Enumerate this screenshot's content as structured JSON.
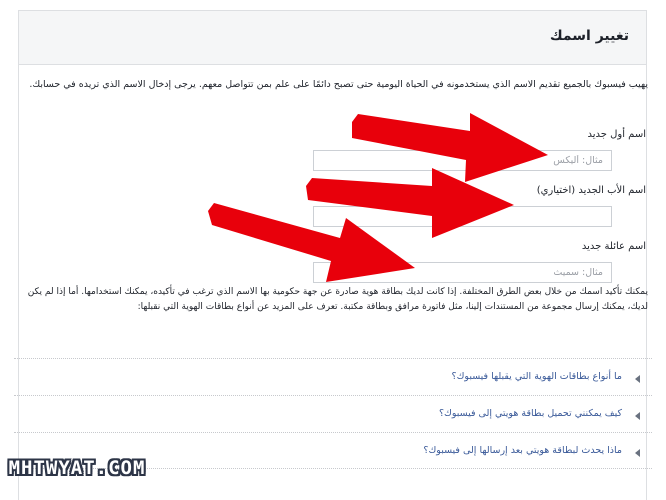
{
  "panel": {
    "title": "تغيير اسمك"
  },
  "intro": "يهيب فيسبوك بالجميع تقديم الاسم الذي يستخدمونه في الحياة اليومية حتى تصبح دائمًا على علم بمن تتواصل معهم. يرجى إدخال الاسم الذي تريده في حسابك.",
  "fields": {
    "first": {
      "label": "اسم أول جديد",
      "placeholder": "مثال: أليكس",
      "value": ""
    },
    "middle": {
      "label": "اسم الأب الجديد (اختياري)",
      "placeholder": "",
      "value": ""
    },
    "last": {
      "label": "اسم عائلة جديد",
      "placeholder": "مثال: سميث",
      "value": ""
    }
  },
  "info": "يمكنك تأكيد اسمك من خلال بعض الطرق المختلفة. إذا كانت لديك بطاقة هوية صادرة عن جهة حكومية بها الاسم الذي ترغب في تأكيده، يمكنك استخدامها. أما إذا لم يكن لديك، يمكنك إرسال مجموعة من المستندات إلينا، مثل فاتورة مرافق وبطاقة مكتبة. تعرف على المزيد عن أنواع بطاقات الهوية التي نقبلها:",
  "faq": [
    {
      "label": "ما أنواع بطاقات الهوية التي يقبلها فيسبوك؟"
    },
    {
      "label": "كيف يمكنني تحميل بطاقة هويتي إلى فيسبوك؟"
    },
    {
      "label": "ماذا يحدث لبطاقة هويتي بعد إرسالها إلى فيسبوك؟"
    }
  ],
  "watermark": "MHTWYAT.COM",
  "colors": {
    "arrow": "#e8000b",
    "link": "#385898",
    "header_bg": "#f5f6f7"
  }
}
